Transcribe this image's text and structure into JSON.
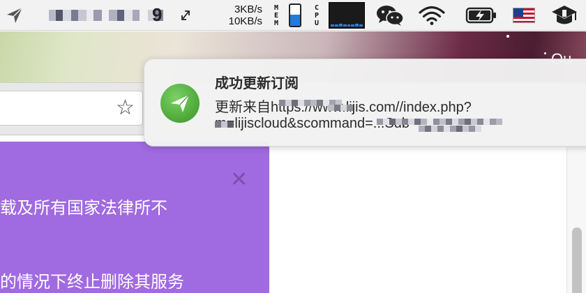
{
  "menubar": {
    "net_up": "3KB/s",
    "net_down": "10KB/s",
    "mem_label": [
      "M",
      "E",
      "M"
    ],
    "cpu_label": [
      "C",
      "P",
      "U"
    ],
    "mem_level_percent": 55,
    "blur_tail": "9",
    "icons": [
      "send-icon",
      "resize-icon",
      "wechat-icon",
      "wifi-icon",
      "battery-charging-icon",
      "us-flag-icon",
      "graduation-icon"
    ]
  },
  "wallpaper": {
    "corner_text": "Ou"
  },
  "notification": {
    "title": "成功更新订阅",
    "line1": "更新来自https://www.lijis.com//index.php?",
    "line2": "m=lijiscloud&scommand=...Sub",
    "app_icon": "send-icon",
    "colors": {
      "icon_green": "#52ad3d"
    }
  },
  "page": {
    "text_line1": "载及所有国家法律所不",
    "text_line2": "的情况下终止删除其服务",
    "close_glyph": "✕",
    "colors": {
      "banner_purple": "#a06ae0"
    }
  }
}
